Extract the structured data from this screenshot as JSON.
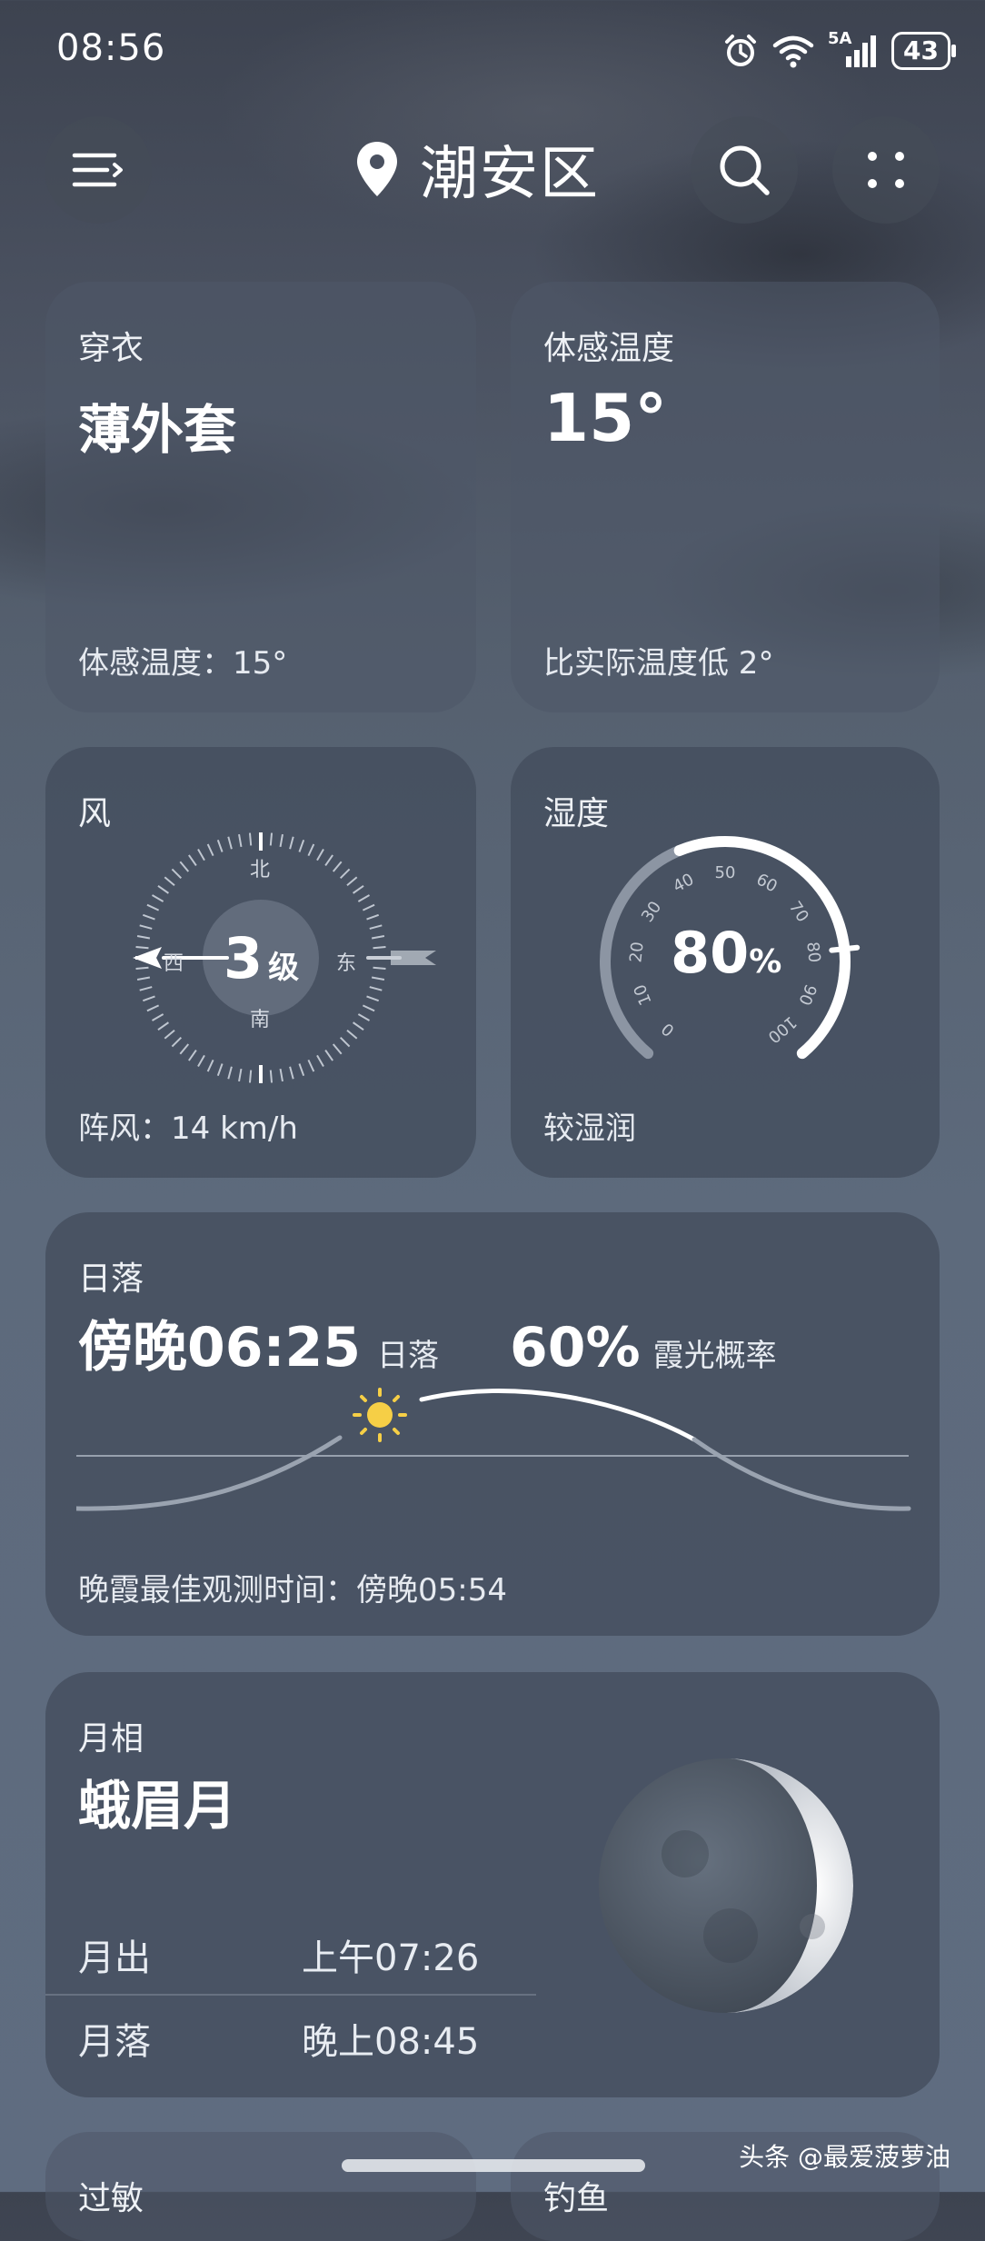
{
  "status_bar": {
    "time": "08:56",
    "network": "5A",
    "battery": "43"
  },
  "header": {
    "location": "潮安区"
  },
  "clothing": {
    "label": "穿衣",
    "value": "薄外套",
    "note": "体感温度：15°"
  },
  "feels_like": {
    "label": "体感温度",
    "value": "15°",
    "note": "比实际温度低 2°"
  },
  "wind": {
    "label": "风",
    "level_number": "3",
    "level_unit": "级",
    "dir_north": "北",
    "dir_south": "南",
    "dir_west": "西",
    "dir_east": "东",
    "gust": "阵风：14 km/h"
  },
  "humidity": {
    "label": "湿度",
    "value_number": "80",
    "value_unit": "%",
    "percent": 80,
    "description": "较湿润",
    "ticks": [
      "0",
      "10",
      "20",
      "30",
      "40",
      "50",
      "60",
      "70",
      "80",
      "90",
      "100"
    ]
  },
  "sunset": {
    "label": "日落",
    "time": "傍晚06:25",
    "time_caption": "日落",
    "probability": "60%",
    "probability_caption": "霞光概率",
    "best_viewing": "晚霞最佳观测时间：傍晚05:54"
  },
  "moon": {
    "label": "月相",
    "phase": "蛾眉月",
    "rise_label": "月出",
    "rise_time": "上午07:26",
    "set_label": "月落",
    "set_time": "晚上08:45"
  },
  "bottom_cards": {
    "left_label": "过敏",
    "right_label": "钓鱼"
  },
  "watermark": "头条 @最爱菠萝油"
}
